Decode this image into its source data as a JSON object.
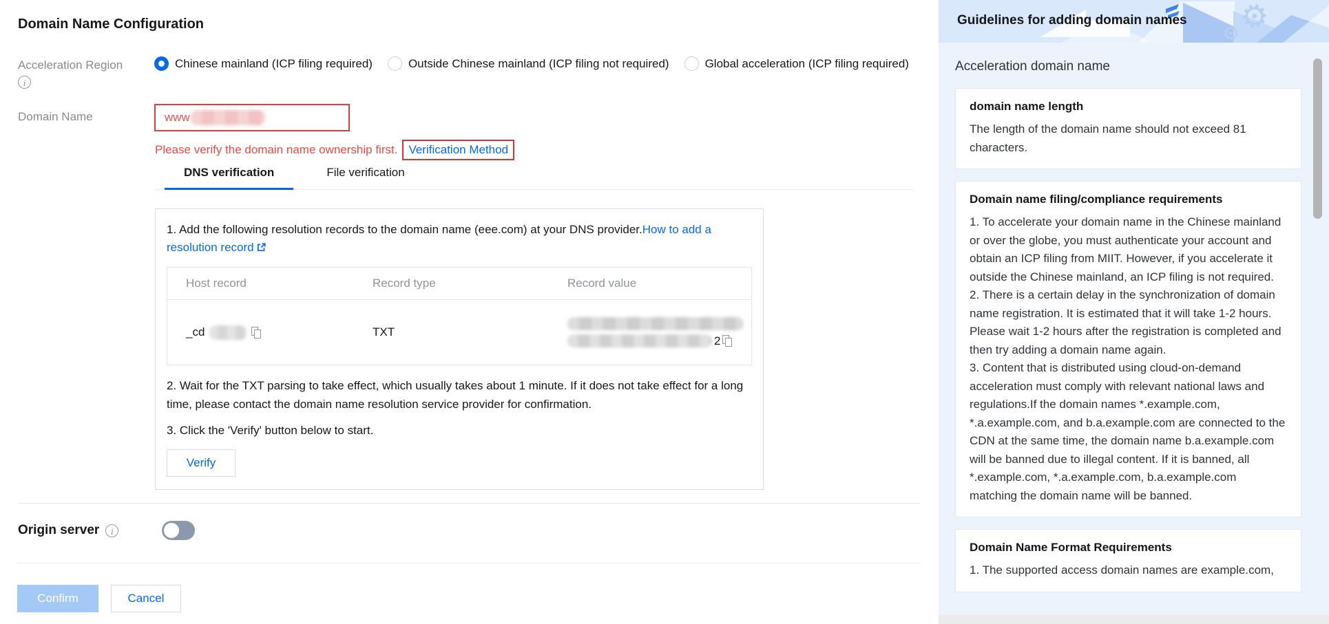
{
  "page": {
    "title": "Domain Name Configuration"
  },
  "colors": {
    "accent_blue": "#0469f0",
    "error_red": "#e54545",
    "panel_header_bg": "#d9e8fb",
    "panel_body_bg": "#edf3fc",
    "confirm_disabled_bg": "#a4c9f7",
    "toggle_off": "#8c99ac"
  },
  "form": {
    "acceleration_region": {
      "label": "Acceleration Region",
      "options": [
        {
          "label": "Chinese mainland (ICP filing required)",
          "selected": true
        },
        {
          "label": "Outside Chinese mainland (ICP filing not required)",
          "selected": false
        },
        {
          "label": "Global acceleration (ICP filing required)",
          "selected": false
        }
      ]
    },
    "domain_name": {
      "label": "Domain Name",
      "value_visible": "www",
      "error": "Please verify the domain name ownership first.",
      "error_link": "Verification Method"
    },
    "verification": {
      "tabs": [
        {
          "label": "DNS verification",
          "active": true
        },
        {
          "label": "File verification",
          "active": false
        }
      ],
      "step1": "1. Add the following resolution records to the domain name (eee.com) at your DNS provider.",
      "step1_link": "How to add a resolution record",
      "table": {
        "headers": [
          "Host record",
          "Record type",
          "Record value"
        ],
        "row": {
          "host_prefix": "_cd",
          "record_type": "TXT",
          "value_suffix": "2"
        }
      },
      "step2": "2. Wait for the TXT parsing to take effect, which usually takes about 1 minute. If it does not take effect for a long time, please contact the domain name resolution service provider for confirmation.",
      "step3": "3. Click the 'Verify' button below to start.",
      "verify_label": "Verify"
    },
    "origin_server": {
      "label": "Origin server",
      "enabled": false
    }
  },
  "actions": {
    "confirm": "Confirm",
    "cancel": "Cancel"
  },
  "sidebar": {
    "title": "Guidelines for adding domain names",
    "section_title": "Acceleration domain name",
    "cards": [
      {
        "title": "domain name length",
        "body": "The length of the domain name should not exceed 81 characters."
      },
      {
        "title": "Domain name filing/compliance requirements",
        "body": "1. To accelerate your domain name in the Chinese mainland or over the globe, you must authenticate your account and obtain an ICP filing from MIIT. However, if you accelerate it outside the Chinese mainland, an ICP filing is not required.\n2. There is a certain delay in the synchronization of domain name registration. It is estimated that it will take 1-2 hours. Please wait 1-2 hours after the registration is completed and then try adding a domain name again.\n3. Content that is distributed using cloud-on-demand acceleration must comply with relevant national laws and regulations.If the domain names *.example.com, *.a.example.com, and b.a.example.com are connected to the CDN at the same time, the domain name b.a.example.com will be banned due to illegal content. If it is banned, all *.example.com, *.a.example.com, b.a.example.com matching the domain name will be banned."
      },
      {
        "title": "Domain Name Format Requirements",
        "body": "1. The supported access domain names are example.com,"
      }
    ]
  }
}
